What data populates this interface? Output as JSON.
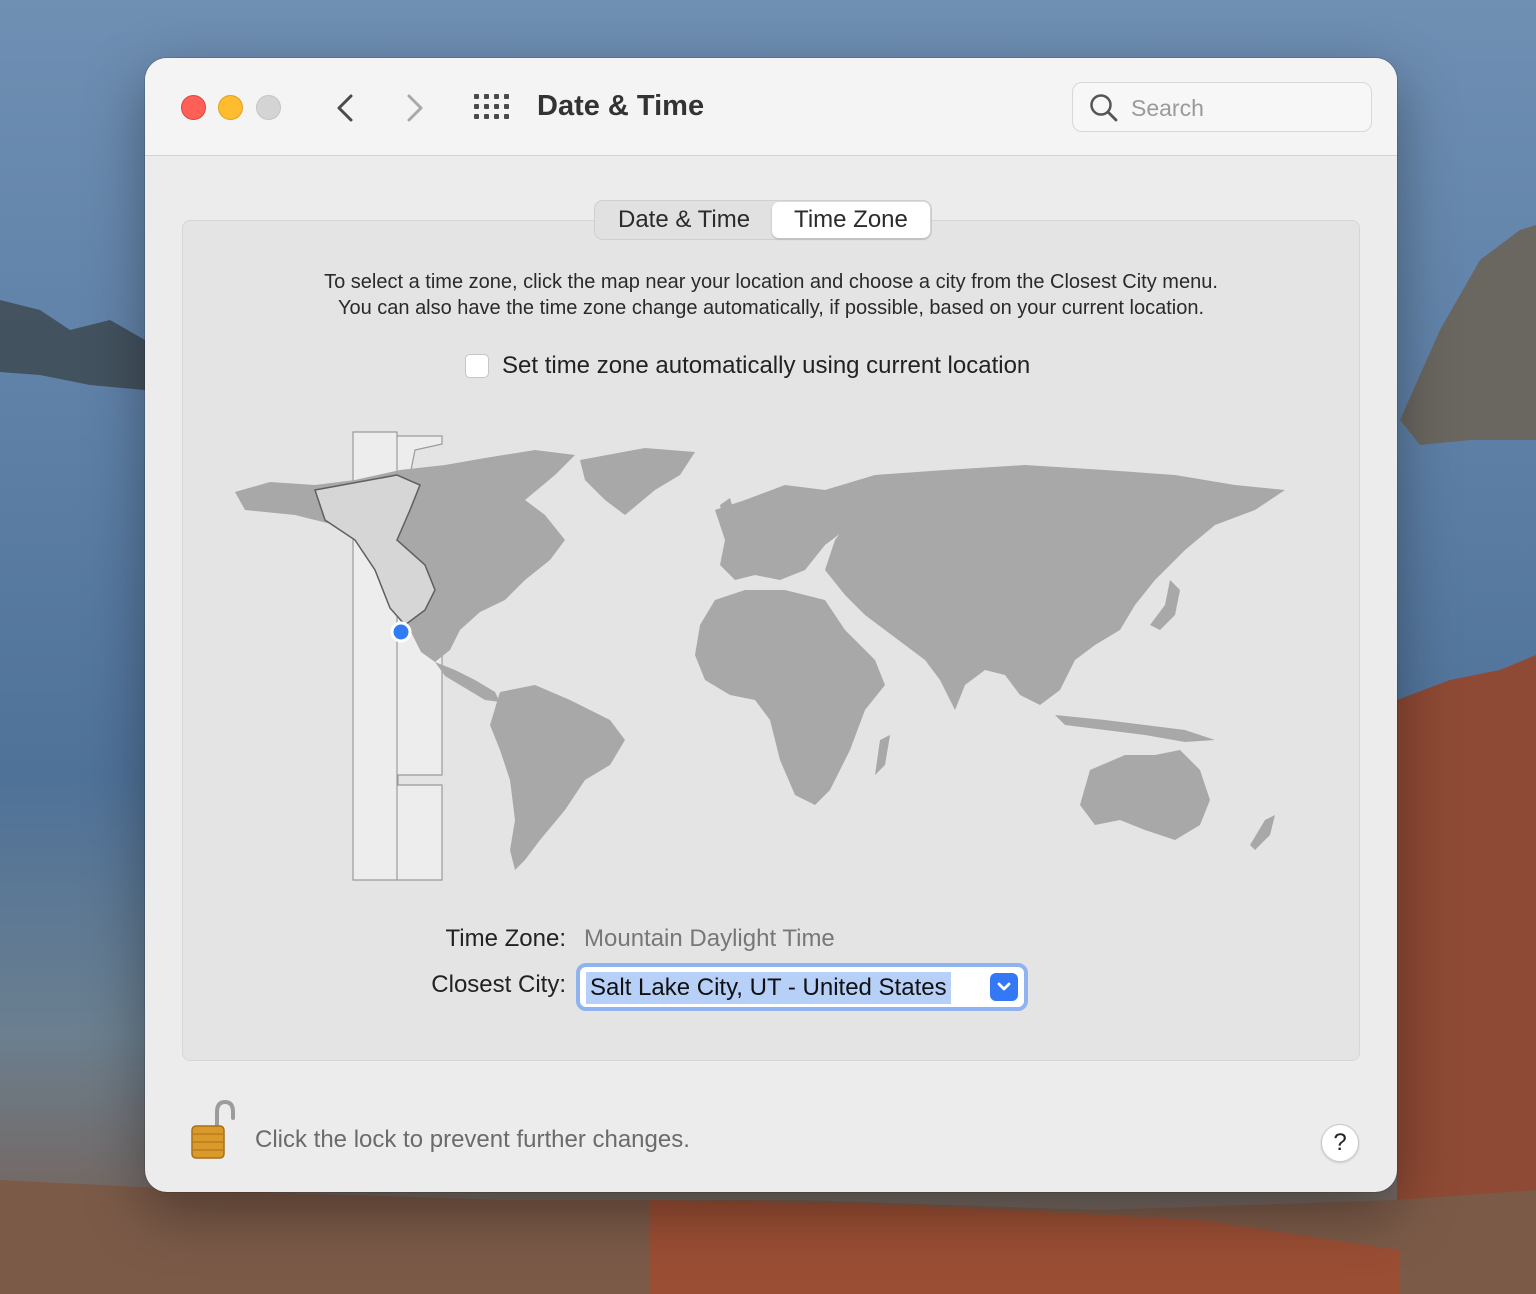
{
  "window": {
    "title": "Date & Time",
    "search_placeholder": "Search"
  },
  "tabs": [
    {
      "label": "Date & Time",
      "active": false
    },
    {
      "label": "Time Zone",
      "active": true
    }
  ],
  "instructions": {
    "line1": "To select a time zone, click the map near your location and choose a city from the Closest City menu.",
    "line2": "You can also have the time zone change automatically, if possible, based on your current location."
  },
  "auto_timezone": {
    "label": "Set time zone automatically using current location",
    "checked": false
  },
  "time_zone": {
    "label": "Time Zone:",
    "value": "Mountain Daylight Time"
  },
  "closest_city": {
    "label": "Closest City:",
    "value": "Salt Lake City, UT - United States"
  },
  "lock": {
    "text": "Click the lock to prevent further changes.",
    "state": "unlocked"
  },
  "help": {
    "label": "?"
  },
  "colors": {
    "accent": "#3478f6",
    "close": "#fe5f57",
    "minimize": "#febc2e",
    "zoom_disabled": "#d4d4d4",
    "land": "#a8a8a8",
    "highlight_zone": "#d9d9d9"
  },
  "icons": {
    "back": "chevron-left-icon",
    "forward": "chevron-right-icon",
    "show_all": "grid-icon",
    "search": "search-icon",
    "lock": "unlocked-padlock-icon",
    "location_marker": "location-dot-icon",
    "popup_arrow": "chevron-down-icon"
  }
}
